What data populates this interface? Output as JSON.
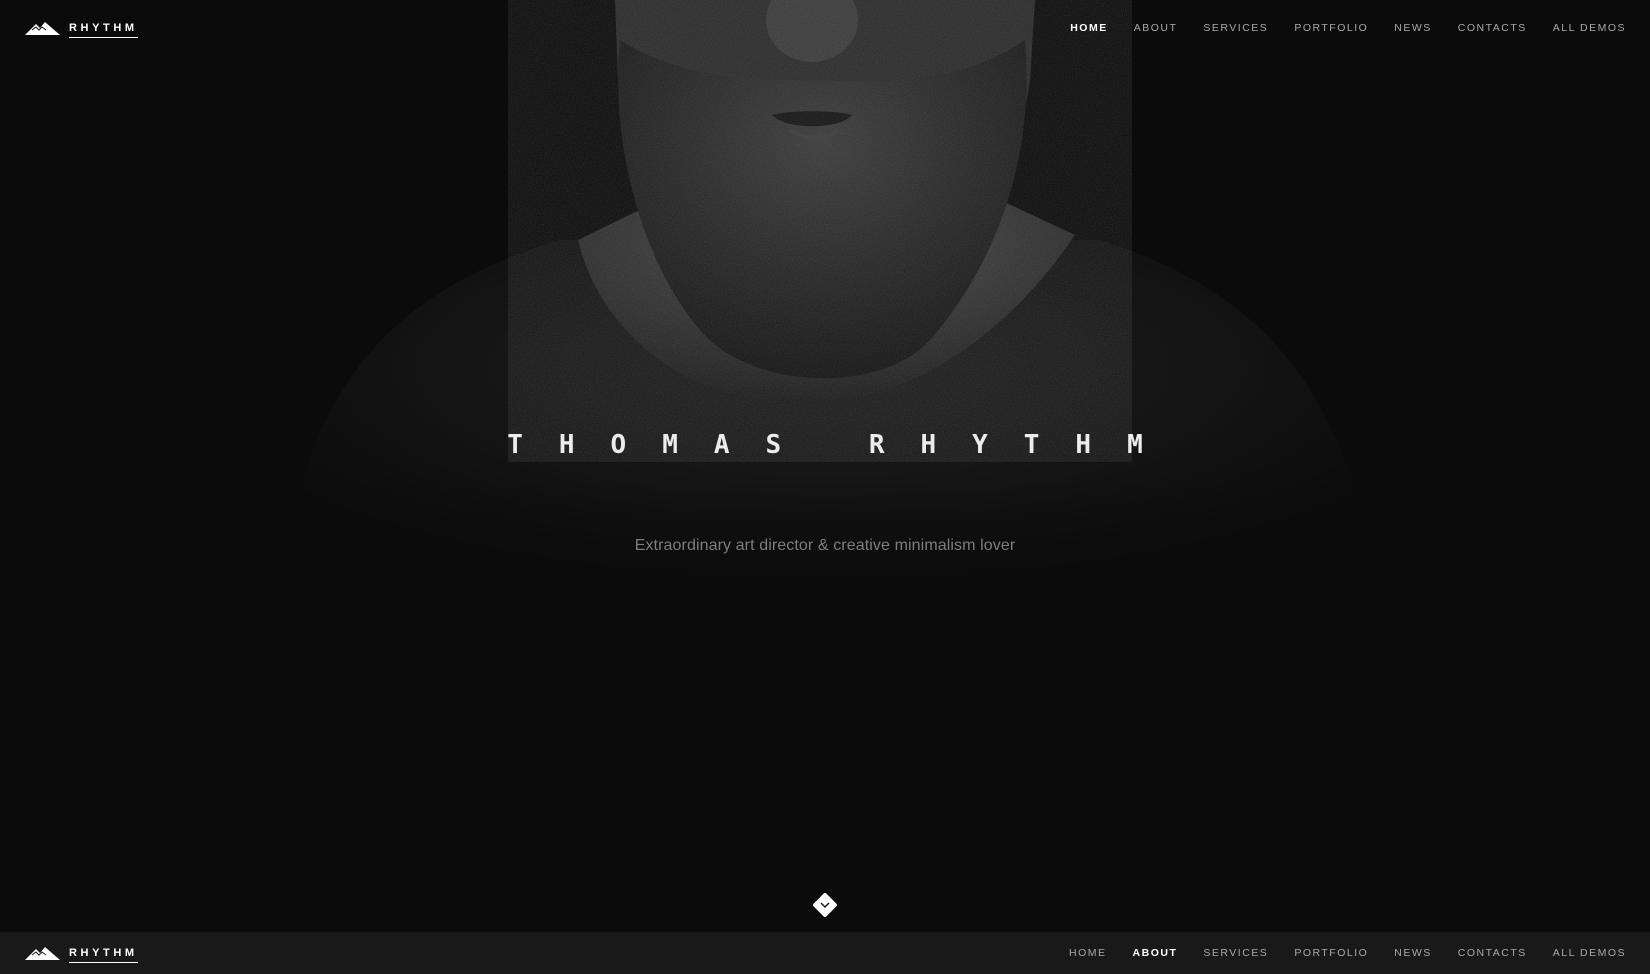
{
  "brand": {
    "name": "RHYTHM",
    "icon": "mountain-logo-icon"
  },
  "nav_top": {
    "items": [
      {
        "label": "HOME",
        "active": true
      },
      {
        "label": "ABOUT",
        "active": false
      },
      {
        "label": "SERVICES",
        "active": false
      },
      {
        "label": "PORTFOLIO",
        "active": false
      },
      {
        "label": "NEWS",
        "active": false
      },
      {
        "label": "CONTACTS",
        "active": false
      },
      {
        "label": "ALL DEMOS",
        "active": false
      }
    ]
  },
  "nav_bottom": {
    "items": [
      {
        "label": "HOME",
        "active": false
      },
      {
        "label": "ABOUT",
        "active": true
      },
      {
        "label": "SERVICES",
        "active": false
      },
      {
        "label": "PORTFOLIO",
        "active": false
      },
      {
        "label": "NEWS",
        "active": false
      },
      {
        "label": "CONTACTS",
        "active": false
      },
      {
        "label": "ALL DEMOS",
        "active": false
      }
    ]
  },
  "hero": {
    "title": "THOMAS RHYTHM",
    "subtitle": "Extraordinary art director & creative minimalism lover",
    "scroll_icon": "chevron-down-icon"
  },
  "colors": {
    "background": "#0b0b0c",
    "bottom_bar": "#191919",
    "nav_text": "#a9a9a9",
    "nav_active": "#ffffff",
    "subtitle": "#7d7d7d"
  }
}
